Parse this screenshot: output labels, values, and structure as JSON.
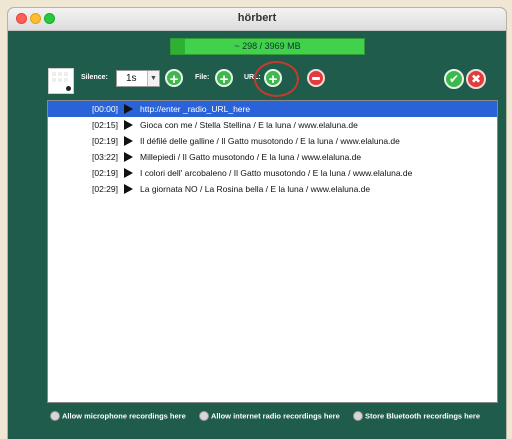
{
  "window": {
    "title": "hörbert"
  },
  "storage": {
    "label": "~ 298 / 3969 MB",
    "used_fraction": 0.075
  },
  "toolbar": {
    "silence_label": "Silence:",
    "silence_value": "1s",
    "file_label": "File:",
    "url_label": "URL:"
  },
  "tracks": [
    {
      "time": "[00:00]",
      "name": "http://enter _radio_URL_here",
      "selected": true
    },
    {
      "time": "[02:15]",
      "name": "Gioca con me / Stella Stellina / E la luna / www.elaluna.de"
    },
    {
      "time": "[02:19]",
      "name": "Il défilé delle galline / Il Gatto musotondo / E la luna / www.elaluna.de"
    },
    {
      "time": "[03:22]",
      "name": "Millepiedi / Il Gatto musotondo / E la luna / www.elaluna.de"
    },
    {
      "time": "[02:19]",
      "name": "I colori dell' arcobaleno / Il Gatto musotondo / E la luna / www.elaluna.de"
    },
    {
      "time": "[02:29]",
      "name": "La giornata NO / La Rosina bella / E la luna / www.elaluna.de"
    }
  ],
  "options": {
    "microphone": "Allow microphone recordings here",
    "internet_radio": "Allow internet radio recordings here",
    "bluetooth": "Store Bluetooth recordings here"
  },
  "colors": {
    "window_bg": "#1f5c4b",
    "selection": "#2a62d8",
    "add": "#3db84c",
    "remove": "#e23b3b"
  }
}
